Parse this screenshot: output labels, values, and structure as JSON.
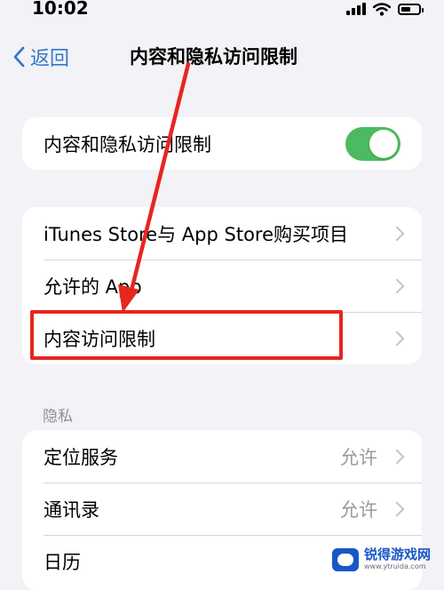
{
  "status_bar": {
    "time": "10:02",
    "battery_level": 0.55,
    "icons": [
      "signal-icon",
      "wifi-icon",
      "battery-icon"
    ]
  },
  "nav": {
    "back_label": "返回",
    "title": "内容和隐私访问限制"
  },
  "main_toggle": {
    "label": "内容和隐私访问限制",
    "on": true
  },
  "store_group": {
    "items": [
      {
        "label": "iTunes Store与 App Store购买项目"
      },
      {
        "label": "允许的 App"
      },
      {
        "label": "内容访问限制"
      }
    ]
  },
  "privacy_section": {
    "header": "隐私",
    "items": [
      {
        "label": "定位服务",
        "value": "允许"
      },
      {
        "label": "通讯录",
        "value": "允许"
      },
      {
        "label": "日历"
      }
    ]
  },
  "colors": {
    "accent": "#3478c6",
    "toggle_on": "#4cbb5f",
    "annotation_red": "#e6261f",
    "background": "#f2f2f7"
  },
  "watermark": {
    "title": "锐得游戏网",
    "url": "www.ytruida.com"
  }
}
